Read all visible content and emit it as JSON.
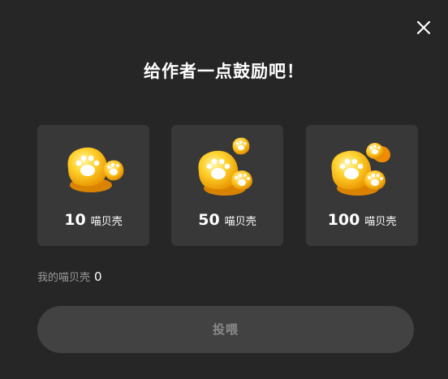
{
  "dialog": {
    "title": "给作者一点鼓励吧！",
    "close_icon": "close-icon"
  },
  "options": [
    {
      "amount": "10",
      "unit": "喵贝壳",
      "icon": "paw-shell-small-icon"
    },
    {
      "amount": "50",
      "unit": "喵贝壳",
      "icon": "paw-shell-medium-icon"
    },
    {
      "amount": "100",
      "unit": "喵贝壳",
      "icon": "paw-shell-large-icon"
    }
  ],
  "balance": {
    "label": "我的喵贝壳",
    "value": "0"
  },
  "feed_button": {
    "label": "投喂"
  },
  "colors": {
    "background": "#262626",
    "card": "#383838",
    "button": "#424242",
    "gold": "#f5b400"
  }
}
